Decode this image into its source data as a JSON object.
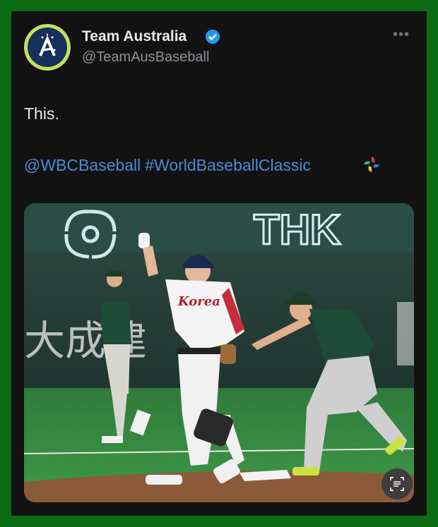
{
  "tweet": {
    "author_name": "Team Australia",
    "author_handle": "@TeamAusBaseball",
    "text": "This.",
    "hashtags": [
      "@WBCBaseball",
      "#WorldBaseballClassic"
    ],
    "more_icon": "more-horizontal-icon",
    "verified_icon": "verified-badge-icon"
  },
  "media": {
    "description_icons": [
      "wbc-logo-icon",
      "visual-search-icon"
    ],
    "visible_text": {
      "sign": "THK",
      "jersey": "Korea",
      "banner": "大成建"
    }
  },
  "colors": {
    "background_frame": "#0b6b12",
    "card": "#121212",
    "link": "#4c8bd6",
    "verified": "#1d9bf0",
    "avatar_ring": "#c6e15a"
  }
}
